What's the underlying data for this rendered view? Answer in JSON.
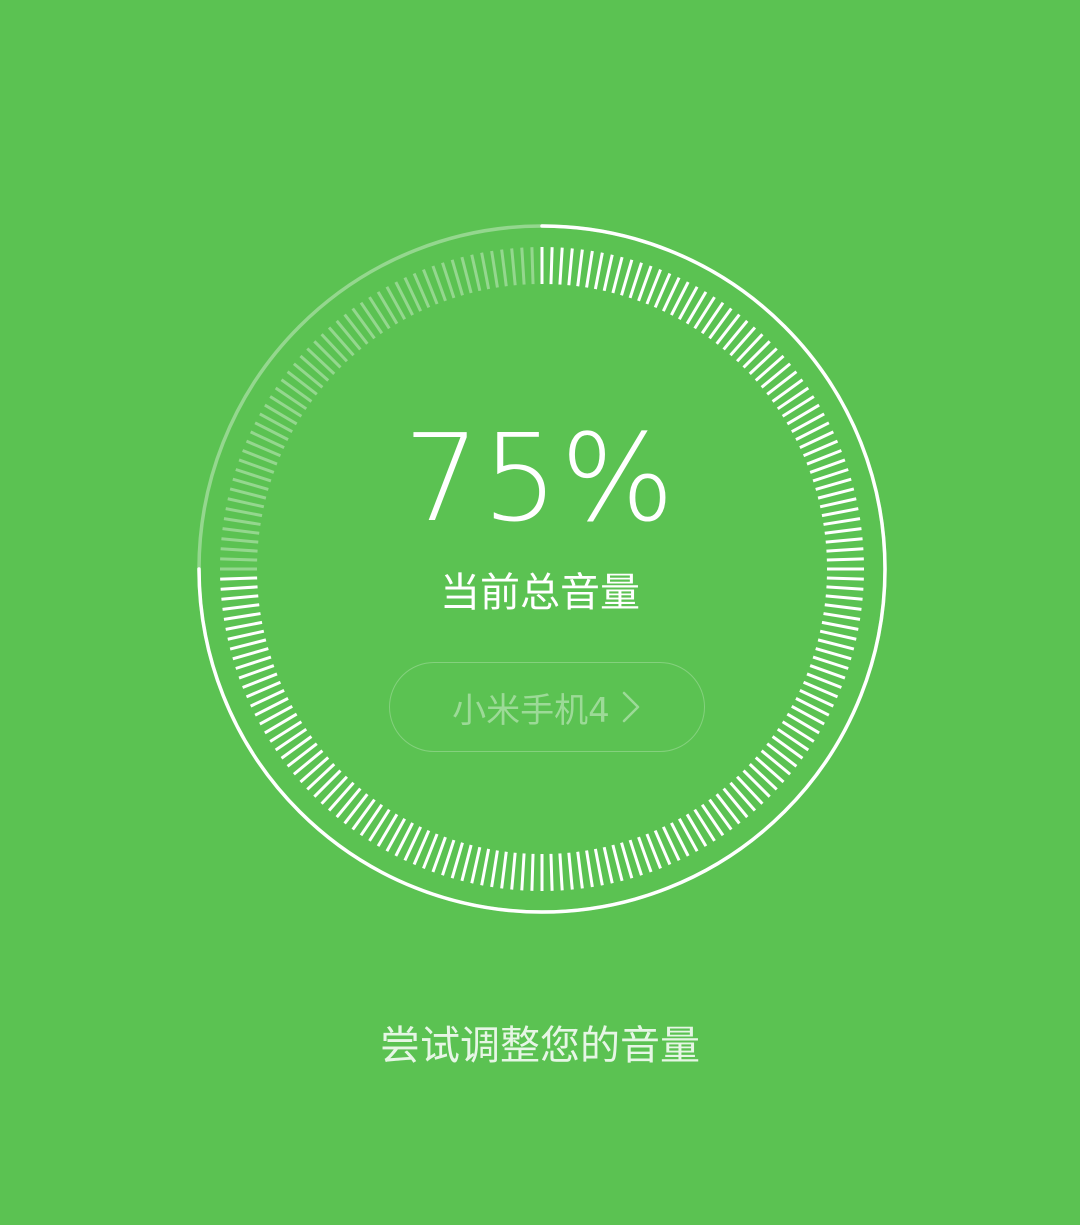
{
  "volume": {
    "percent_text": "75%",
    "level": 0.75,
    "label": "当前总音量"
  },
  "device_button": {
    "name": "小米手机4",
    "icon": "chevron-right-icon"
  },
  "hint": "尝试调整您的音量",
  "colors": {
    "background": "#5bc252",
    "active": "#ffffff",
    "inactive": "rgba(255,255,255,0.35)"
  }
}
